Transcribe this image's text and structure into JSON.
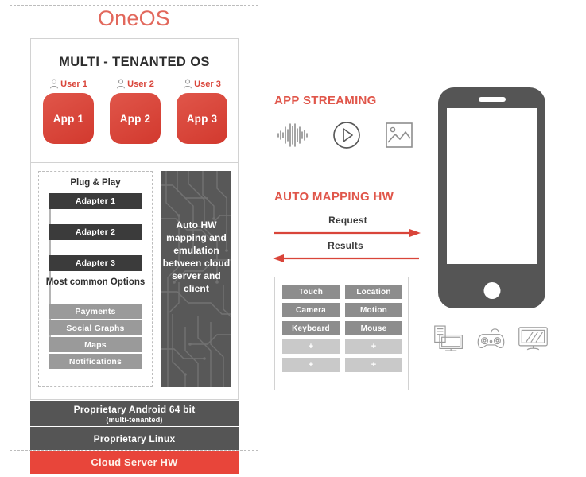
{
  "diagram": {
    "title": "OneOS",
    "accent_red": "#e2685c",
    "dark_gray": "#555555",
    "mid_gray": "#8d8d8d"
  },
  "os_card": {
    "heading": "MULTI - TENANTED OS",
    "users": [
      {
        "user_label": "User 1",
        "app_label": "App 1",
        "icon": "user-icon"
      },
      {
        "user_label": "User 2",
        "app_label": "App 2",
        "icon": "user-icon"
      },
      {
        "user_label": "User 3",
        "app_label": "App 3",
        "icon": "user-icon"
      }
    ]
  },
  "plug_and_play": {
    "title": "Plug & Play",
    "adapters": [
      "Adapter 1",
      "Adapter 2",
      "Adapter 3"
    ],
    "options_title": "Most common Options",
    "options": [
      "Payments",
      "Social Graphs",
      "Maps",
      "Notifications"
    ]
  },
  "circuit_panel": {
    "text": "Auto HW mapping and emulation between cloud server and client"
  },
  "stack_bars": [
    {
      "main": "Proprietary Android 64 bit",
      "sub": "(multi-tenanted)"
    },
    {
      "main": "Proprietary Linux",
      "sub": ""
    },
    {
      "main": "Cloud Server HW",
      "sub": ""
    }
  ],
  "app_streaming": {
    "title": "APP STREAMING",
    "icons": [
      "audio-waveform-icon",
      "play-circle-icon",
      "image-icon"
    ]
  },
  "auto_mapping": {
    "title": "AUTO MAPPING HW",
    "request_label": "Request",
    "results_label": "Results"
  },
  "hw_grid": {
    "cells": [
      {
        "label": "Touch",
        "state": "filled"
      },
      {
        "label": "Location",
        "state": "filled"
      },
      {
        "label": "Camera",
        "state": "filled"
      },
      {
        "label": "Motion",
        "state": "filled"
      },
      {
        "label": "Keyboard",
        "state": "filled"
      },
      {
        "label": "Mouse",
        "state": "filled"
      },
      {
        "label": "+",
        "state": "empty"
      },
      {
        "label": "+",
        "state": "empty"
      },
      {
        "label": "+",
        "state": "empty"
      },
      {
        "label": "+",
        "state": "empty"
      }
    ]
  },
  "client_devices": {
    "phone": "smartphone-icon",
    "icons": [
      "desktop-computer-icon",
      "game-controller-icon",
      "tv-monitor-icon"
    ]
  }
}
